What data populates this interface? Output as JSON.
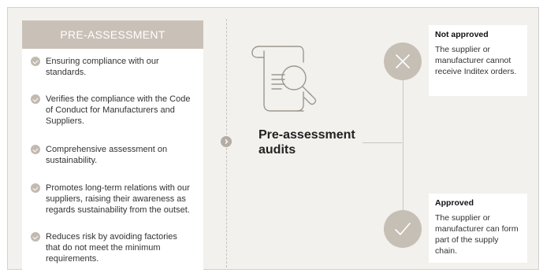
{
  "left": {
    "header": "PRE-ASSESSMENT",
    "items": [
      "Ensuring compliance with our standards.",
      "Verifies the compliance with the Code of Conduct for Manufacturers and Suppliers.",
      "Comprehensive assessment on sustainability.",
      "Promotes long-term relations with our suppliers, raising their awareness as regards sustainability from the outset.",
      "Reduces risk by avoiding factories that do not meet the minimum requirements."
    ]
  },
  "center": {
    "title_line1": "Pre-assessment",
    "title_line2": "audits",
    "icon": "document-search-icon"
  },
  "outcomes": {
    "not_approved": {
      "title": "Not approved",
      "text": "The supplier or manufacturer cannot receive Inditex orders.",
      "icon": "cross-icon"
    },
    "approved": {
      "title": "Approved",
      "text": "The supplier or manufacturer can form part of the supply chain.",
      "icon": "checkmark-icon"
    }
  },
  "colors": {
    "header_bg": "#c9c1b8",
    "background": "#f2f1ee",
    "circle": "#c6bfb6",
    "bullet": "#c2bab0"
  }
}
